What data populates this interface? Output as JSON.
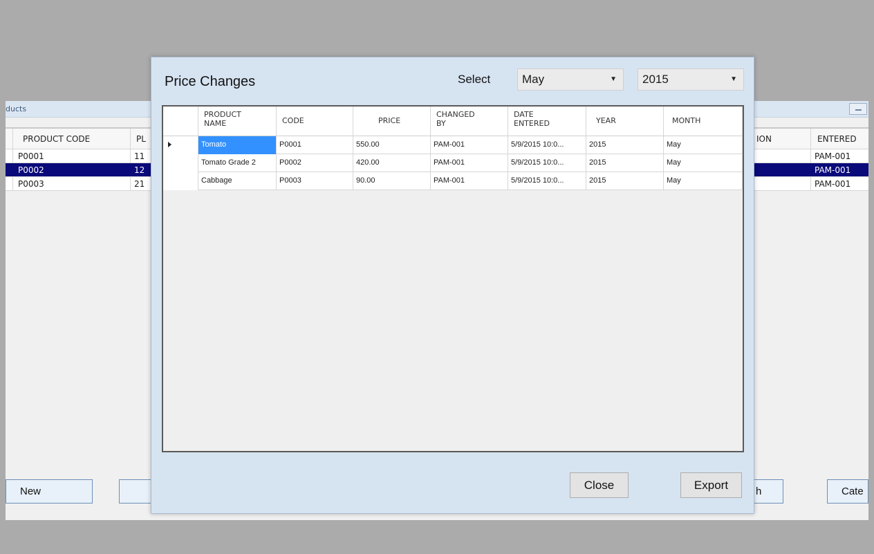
{
  "background_window": {
    "title": "ducts",
    "left_grid": {
      "headers": [
        "PRODUCT CODE",
        "PL"
      ],
      "rows": [
        [
          "P0001",
          "11"
        ],
        [
          "P0002",
          "12"
        ],
        [
          "P0003",
          "21"
        ]
      ],
      "selected_row": 1
    },
    "right_grid": {
      "headers": [
        "ION",
        "ENTERED"
      ],
      "rows": [
        [
          "",
          "PAM-001"
        ],
        [
          "",
          "PAM-001"
        ],
        [
          "",
          "PAM-001"
        ]
      ]
    },
    "buttons": {
      "new": "New",
      "cate": "Cate",
      "partial": "h"
    }
  },
  "dialog": {
    "title": "Price Changes",
    "select_label": "Select",
    "month": "May",
    "year": "2015",
    "columns": {
      "product_name": [
        "PRODUCT",
        "NAME"
      ],
      "code": "CODE",
      "price": "PRICE",
      "changed_by": [
        "CHANGED",
        "BY"
      ],
      "date_entered": [
        "DATE",
        "ENTERED"
      ],
      "year": "YEAR",
      "month": "MONTH"
    },
    "rows": [
      {
        "product_name": "Tomato",
        "code": "P0001",
        "price": "550.00",
        "changed_by": "PAM-001",
        "date_entered": "5/9/2015 10:0...",
        "year": "2015",
        "month": "May"
      },
      {
        "product_name": "Tomato Grade 2",
        "code": "P0002",
        "price": "420.00",
        "changed_by": "PAM-001",
        "date_entered": "5/9/2015 10:0...",
        "year": "2015",
        "month": "May"
      },
      {
        "product_name": "Cabbage",
        "code": "P0003",
        "price": "90.00",
        "changed_by": "PAM-001",
        "date_entered": "5/9/2015 10:0...",
        "year": "2015",
        "month": "May"
      }
    ],
    "current_row": 0,
    "close_label": "Close",
    "export_label": "Export"
  },
  "colors": {
    "selection": "#0a0a7a",
    "current_cell": "#3391ff",
    "dialog_bg": "#d6e3f1"
  }
}
